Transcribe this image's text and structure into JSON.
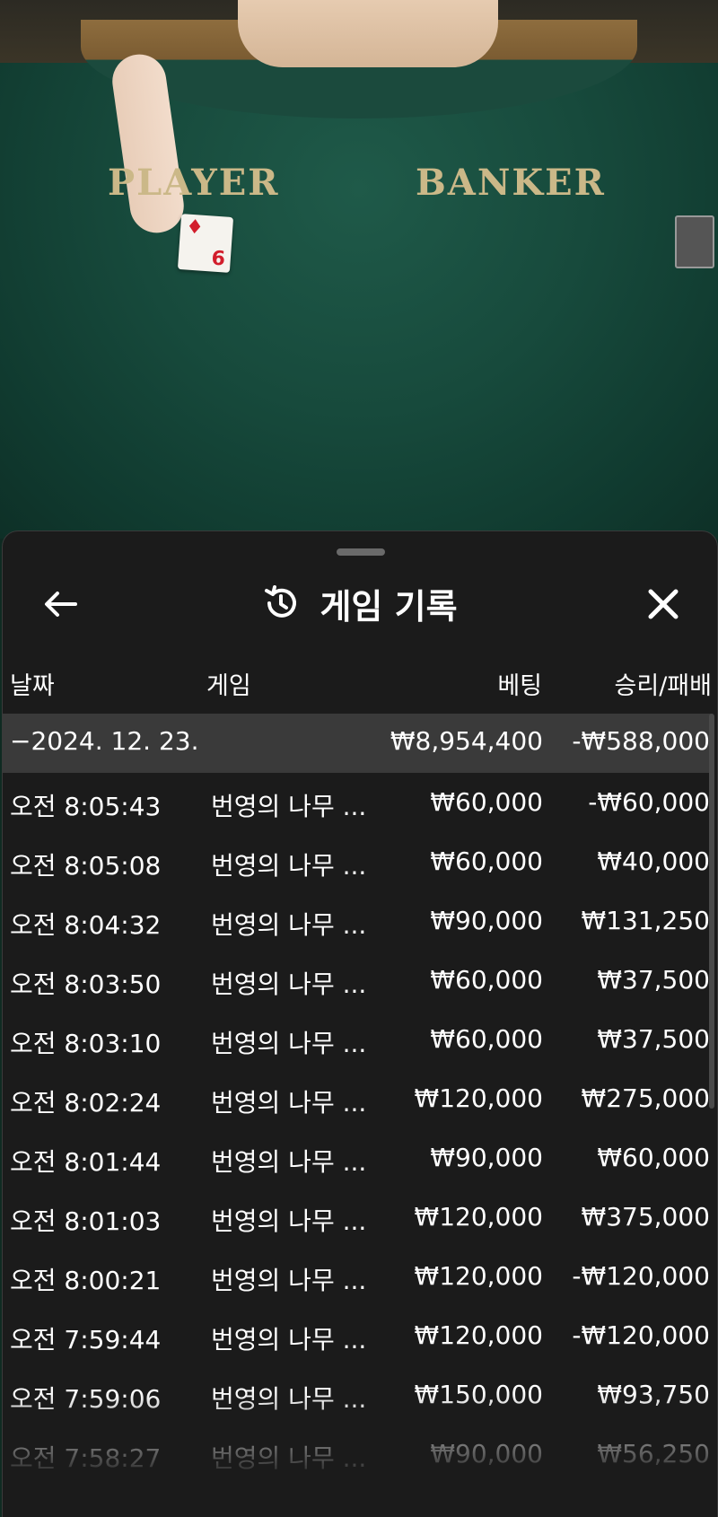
{
  "video": {
    "player_label": "PLAYER",
    "banker_label": "BANKER",
    "card_rank": "6",
    "card_suit": "♦"
  },
  "header": {
    "title": "게임 기록",
    "back_icon": "arrow-left-icon",
    "history_icon": "history-icon",
    "close_icon": "close-icon"
  },
  "columns": {
    "date": "날짜",
    "game": "게임",
    "bet": "베팅",
    "win_loss": "승리/패배"
  },
  "day_group": {
    "date": "−2024. 12. 23.",
    "bet_total": "₩8,954,400",
    "win_total": "-₩588,000"
  },
  "rows": [
    {
      "time": "오전 8:05:43",
      "game": "번영의 나무 ...",
      "bet": "₩60,000",
      "win": "-₩60,000"
    },
    {
      "time": "오전 8:05:08",
      "game": "번영의 나무 ...",
      "bet": "₩60,000",
      "win": "₩40,000"
    },
    {
      "time": "오전 8:04:32",
      "game": "번영의 나무 ...",
      "bet": "₩90,000",
      "win": "₩131,250"
    },
    {
      "time": "오전 8:03:50",
      "game": "번영의 나무 ...",
      "bet": "₩60,000",
      "win": "₩37,500"
    },
    {
      "time": "오전 8:03:10",
      "game": "번영의 나무 ...",
      "bet": "₩60,000",
      "win": "₩37,500"
    },
    {
      "time": "오전 8:02:24",
      "game": "번영의 나무 ...",
      "bet": "₩120,000",
      "win": "₩275,000"
    },
    {
      "time": "오전 8:01:44",
      "game": "번영의 나무 ...",
      "bet": "₩90,000",
      "win": "₩60,000"
    },
    {
      "time": "오전 8:01:03",
      "game": "번영의 나무 ...",
      "bet": "₩120,000",
      "win": "₩375,000"
    },
    {
      "time": "오전 8:00:21",
      "game": "번영의 나무 ...",
      "bet": "₩120,000",
      "win": "-₩120,000"
    },
    {
      "time": "오전 7:59:44",
      "game": "번영의 나무 ...",
      "bet": "₩120,000",
      "win": "-₩120,000"
    },
    {
      "time": "오전 7:59:06",
      "game": "번영의 나무 ...",
      "bet": "₩150,000",
      "win": "₩93,750"
    },
    {
      "time": "오전 7:58:27",
      "game": "번영의 나무 ...",
      "bet": "₩90,000",
      "win": "₩56,250"
    }
  ]
}
